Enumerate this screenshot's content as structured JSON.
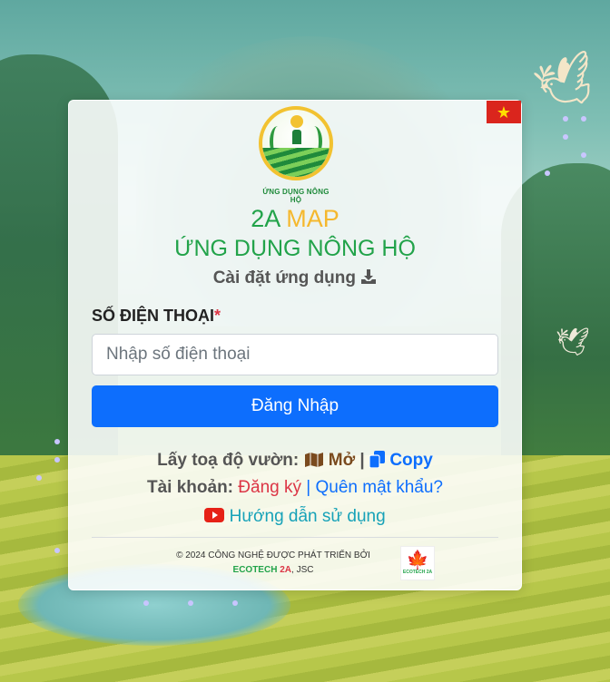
{
  "app": {
    "logo_text": "ỨNG DỤNG NÔNG HỘ",
    "title_part1": "2A",
    "title_part2": "MAP",
    "subtitle": "ỨNG DỤNG NÔNG HỘ",
    "install_label": "Cài đặt ứng dụng",
    "language_flag": "vietnam-flag-icon"
  },
  "form": {
    "phone_label": "SỐ ĐIỆN THOẠI",
    "required_mark": "*",
    "phone_placeholder": "Nhập số điện thoại",
    "phone_value": "",
    "login_button": "Đăng Nhập"
  },
  "links": {
    "coords_label": "Lấy toạ độ vườn:",
    "open_label": "Mở",
    "separator": "|",
    "copy_label": "Copy",
    "account_label": "Tài khoản:",
    "register_label": "Đăng ký",
    "forgot_label": "Quên mật khẩu?",
    "guide_label": "Hướng dẫn sử dụng"
  },
  "footer": {
    "copyright_line": "© 2024 CÔNG NGHỆ ĐƯỢC PHÁT TRIỂN BỞI",
    "company_eco": "ECOTECH",
    "company_2a": "2A",
    "company_suffix": ", JSC",
    "logo_text": "ECOTECH 2A"
  },
  "colors": {
    "primary": "#0d6efd",
    "green": "#22a34a",
    "gold": "#f5b82e",
    "danger": "#dc3545",
    "info": "#17a2b8"
  }
}
